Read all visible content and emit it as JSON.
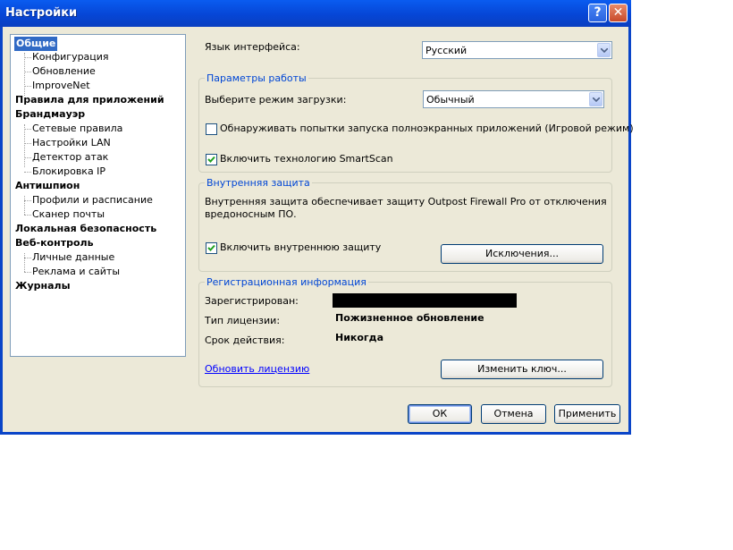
{
  "window": {
    "title": "Настройки"
  },
  "tree": {
    "items": [
      {
        "label": "Общие"
      },
      {
        "label": "Конфигурация"
      },
      {
        "label": "Обновление"
      },
      {
        "label": "ImproveNet"
      },
      {
        "label": "Правила для приложений"
      },
      {
        "label": "Брандмауэр"
      },
      {
        "label": "Сетевые правила"
      },
      {
        "label": "Настройки LAN"
      },
      {
        "label": "Детектор атак"
      },
      {
        "label": "Блокировка IP"
      },
      {
        "label": "Антишпион"
      },
      {
        "label": "Профили и расписание"
      },
      {
        "label": "Сканер почты"
      },
      {
        "label": "Локальная безопасность"
      },
      {
        "label": "Веб-контроль"
      },
      {
        "label": "Личные данные"
      },
      {
        "label": "Реклама и сайты"
      },
      {
        "label": "Журналы"
      }
    ]
  },
  "language": {
    "label": "Язык интерфейса:",
    "value": "Русский"
  },
  "work": {
    "title": "Параметры работы",
    "boot_label": "Выберите режим загрузки:",
    "boot_value": "Обычный",
    "game_mode_label": "Обнаруживать попытки запуска полноэкранных приложений (Игровой режим)",
    "game_mode_checked": false,
    "smartscan_label": "Включить технологию SmartScan",
    "smartscan_checked": true
  },
  "internal": {
    "title": "Внутренняя защита",
    "description_line1": "Внутренняя защита обеспечивает защиту Outpost Firewall Pro от отключения",
    "description_line2": "вредоносным ПО.",
    "enable_label": "Включить внутреннюю защиту",
    "enable_checked": true,
    "exclusions_button": "Исключения..."
  },
  "registration": {
    "title": "Регистрационная информация",
    "registered_label": "Зарегистрирован:",
    "license_type_label": "Тип лицензии:",
    "license_type_value": "Пожизненное обновление",
    "validity_label": "Срок действия:",
    "validity_value": "Никогда",
    "renew_link": "Обновить лицензию",
    "change_key_button": "Изменить ключ..."
  },
  "footer": {
    "ok": "ОК",
    "cancel": "Отмена",
    "apply": "Применить"
  }
}
